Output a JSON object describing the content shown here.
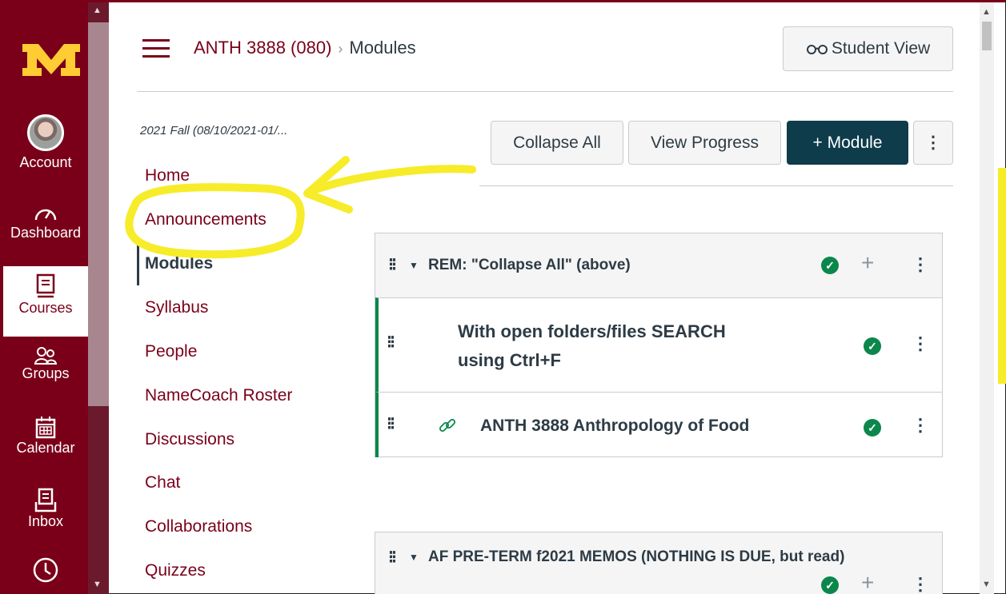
{
  "global_nav": {
    "account_label": "Account",
    "dashboard_label": "Dashboard",
    "courses_label": "Courses",
    "groups_label": "Groups",
    "calendar_label": "Calendar",
    "inbox_label": "Inbox"
  },
  "header": {
    "course": "ANTH 3888 (080)",
    "separator": "›",
    "page": "Modules",
    "student_view_label": "Student View"
  },
  "course_nav": {
    "term": "2021 Fall (08/10/2021-01/...",
    "items": [
      "Home",
      "Announcements",
      "Modules",
      "Syllabus",
      "People",
      "NameCoach Roster",
      "Discussions",
      "Chat",
      "Collaborations",
      "Quizzes"
    ]
  },
  "toolbar": {
    "collapse_all": "Collapse All",
    "view_progress": "View Progress",
    "add_module": "+ Module",
    "more": "⋮"
  },
  "modules": [
    {
      "title": "REM: \"Collapse All\" (above)",
      "items": [
        {
          "title_line1": "With open folders/files SEARCH",
          "title_line2": "using Ctrl+F"
        },
        {
          "title": "ANTH 3888 Anthropology of Food"
        }
      ]
    },
    {
      "title": "AF PRE-TERM f2021 MEMOS (NOTHING IS DUE, but read)"
    }
  ],
  "colors": {
    "brand_maroon": "#7a0019",
    "module_button": "#0e3c4b",
    "published_green": "#0b874b",
    "annotation_yellow": "#f6ec2a"
  }
}
